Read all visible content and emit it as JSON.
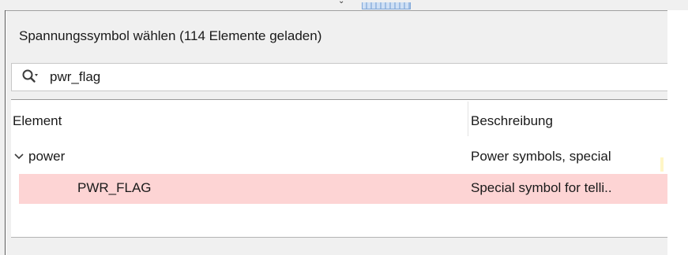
{
  "dialog": {
    "title": "Spannungssymbol wählen (114 Elemente geladen)"
  },
  "search": {
    "value": "pwr_flag",
    "icon": "search-icon-with-dropdown"
  },
  "table": {
    "columns": [
      "Element",
      "Beschreibung"
    ],
    "rows": [
      {
        "element": "power",
        "description": "Power symbols, special",
        "expanded": true,
        "selected": false
      },
      {
        "element": "PWR_FLAG",
        "description": "Special symbol for telli..",
        "expanded": false,
        "selected": true
      }
    ]
  },
  "colors": {
    "selection": "#fdd4d4",
    "background": "#f0f0f0"
  }
}
